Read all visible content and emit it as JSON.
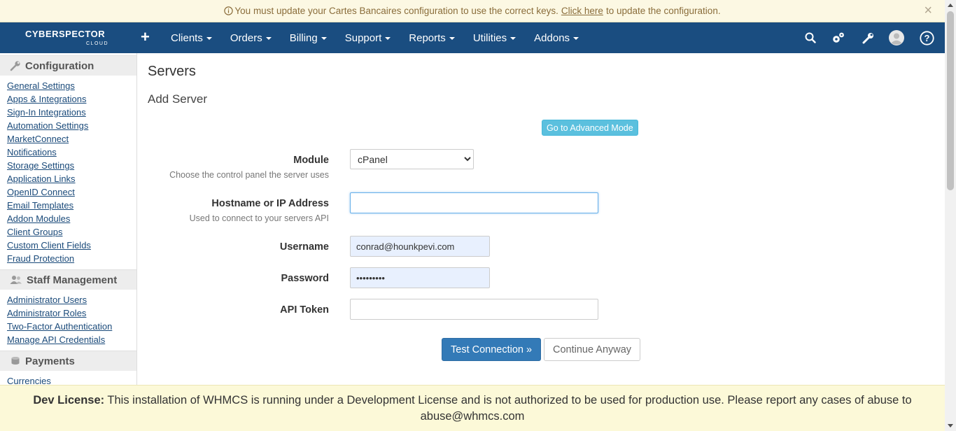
{
  "alert": {
    "text_before": "You must update your Cartes Bancaires configuration to use the correct keys.",
    "link": "Click here",
    "text_after": "to update the configuration.",
    "close": "×"
  },
  "brand": {
    "name_top": "CYBERSPECTOR",
    "name_sub": "CLOUD"
  },
  "nav": {
    "add": "+",
    "items": [
      "Clients",
      "Orders",
      "Billing",
      "Support",
      "Reports",
      "Utilities",
      "Addons"
    ],
    "icons": [
      "search-icon",
      "settings-icon",
      "wrench-icon",
      "user-avatar-icon",
      "help-icon"
    ]
  },
  "sidebar": {
    "sections": [
      {
        "title": "Configuration",
        "icon": "wrench-icon",
        "links": [
          "General Settings",
          "Apps & Integrations",
          "Sign-In Integrations",
          "Automation Settings",
          "MarketConnect",
          "Notifications",
          "Storage Settings",
          "Application Links",
          "OpenID Connect",
          "Email Templates",
          "Addon Modules",
          "Client Groups",
          "Custom Client Fields",
          "Fraud Protection"
        ]
      },
      {
        "title": "Staff Management",
        "icon": "users-icon",
        "links": [
          "Administrator Users",
          "Administrator Roles",
          "Two-Factor Authentication",
          "Manage API Credentials"
        ]
      },
      {
        "title": "Payments",
        "icon": "coins-icon",
        "links": [
          "Currencies"
        ]
      }
    ]
  },
  "main": {
    "title": "Servers",
    "subtitle": "Add Server",
    "advanced_button": "Go to Advanced Mode",
    "form": {
      "module_label": "Module",
      "module_help": "Choose the control panel the server uses",
      "module_value": "cPanel",
      "hostname_label": "Hostname or IP Address",
      "hostname_help": "Used to connect to your servers API",
      "hostname_value": "",
      "username_label": "Username",
      "username_value": "conrad@hounkpevi.com",
      "password_label": "Password",
      "password_value": "•••••••••",
      "token_label": "API Token",
      "token_value": ""
    },
    "test_button": "Test Connection »",
    "continue_button": "Continue Anyway"
  },
  "dev_notice": {
    "label": "Dev License:",
    "text": "This installation of WHMCS is running under a Development License and is not authorized to be used for production use. Please report any cases of abuse to abuse@whmcs.com"
  },
  "colors": {
    "navbar": "#1a4d80",
    "primary": "#337ab7",
    "info": "#5bc0de",
    "alert_bg": "#fcf8e3",
    "dev_bg": "#fcf9d8"
  }
}
